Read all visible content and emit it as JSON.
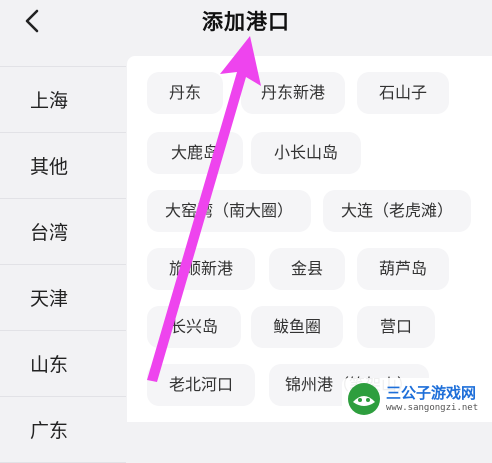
{
  "header": {
    "title": "添加港口"
  },
  "sidebar": {
    "items": [
      {
        "label": "上海"
      },
      {
        "label": "其他"
      },
      {
        "label": "台湾"
      },
      {
        "label": "天津"
      },
      {
        "label": "山东"
      },
      {
        "label": "广东"
      }
    ]
  },
  "ports": [
    "丹东",
    "丹东新港",
    "石山子",
    "大鹿岛",
    "小长山岛",
    "大窑湾（南大圈）",
    "大连（老虎滩）",
    "旅顺新港",
    "金县",
    "葫芦岛",
    "长兴岛",
    "鲅鱼圈",
    "营口",
    "老北河口",
    "锦州港（笔架山）"
  ],
  "watermark": {
    "title": "三公子游戏网",
    "url": "www.sangongzi.net"
  },
  "colors": {
    "accent_arrow": "#ee44ee",
    "background": "#f2f2f4",
    "chip": "#f5f5f7"
  }
}
